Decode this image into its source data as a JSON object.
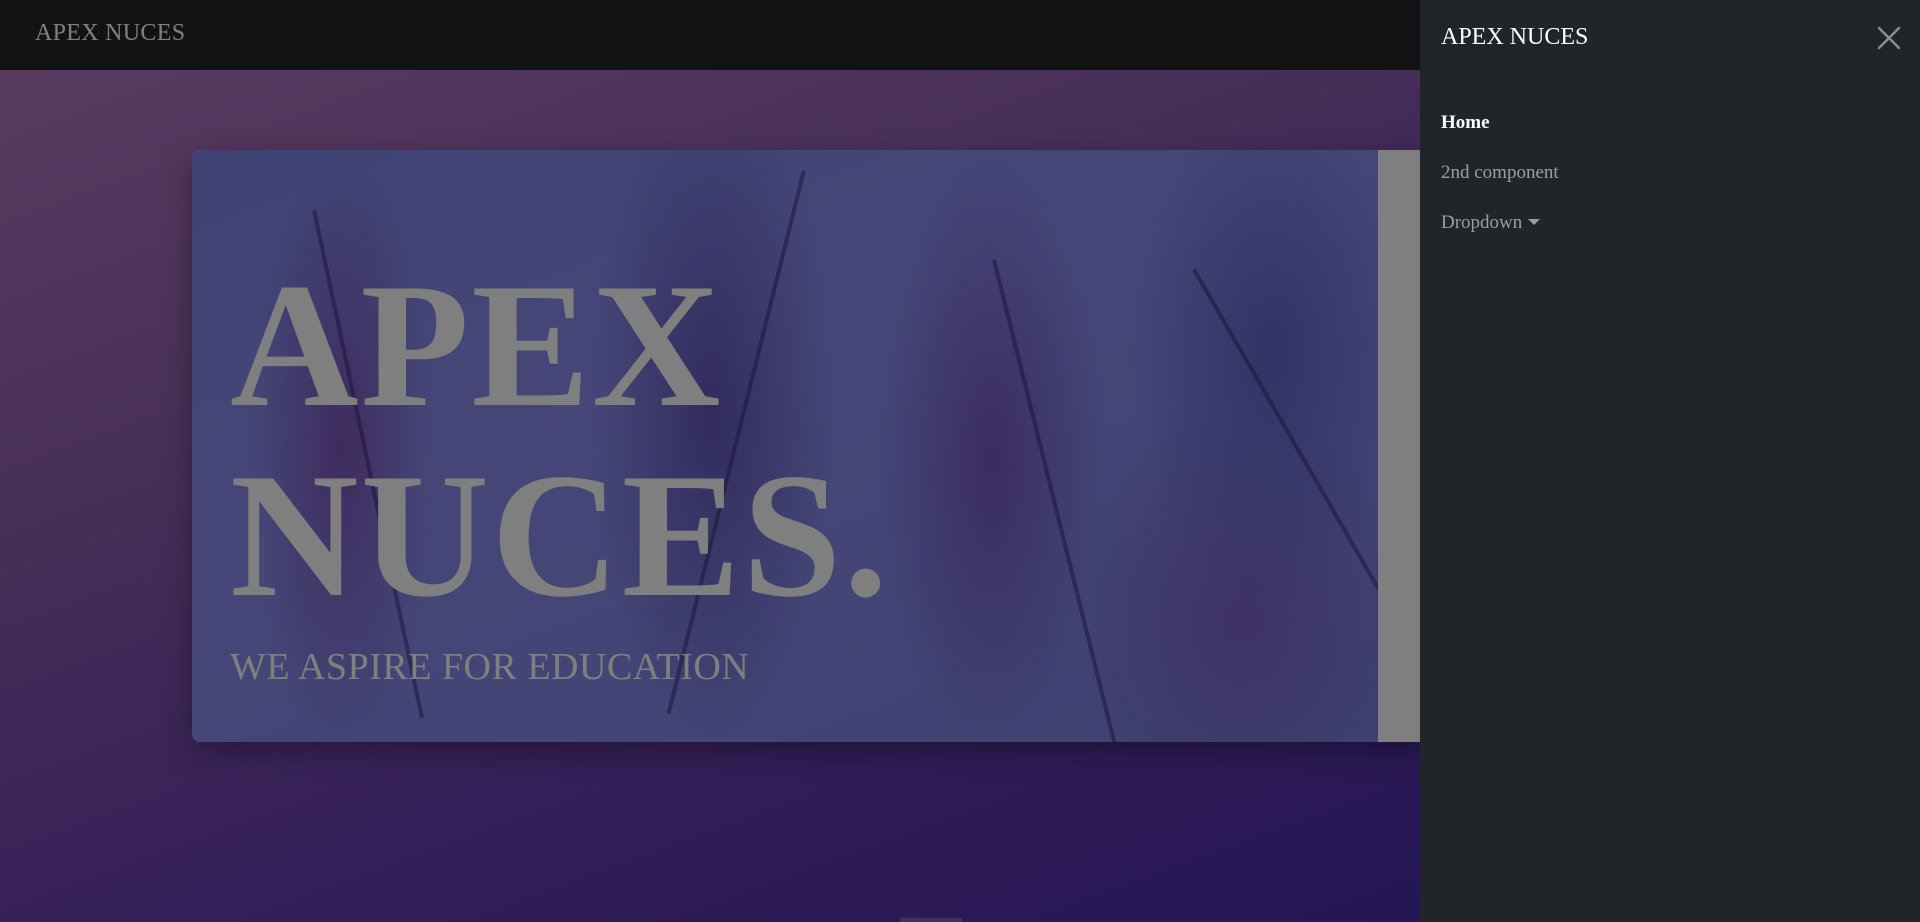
{
  "navbar": {
    "brand": "APEX NUCES"
  },
  "hero": {
    "title_line1": "APEX",
    "title_line2": "NUCES.",
    "tagline": "WE ASPIRE FOR EDUCATION"
  },
  "offcanvas": {
    "title": "APEX NUCES",
    "close_icon": "close-icon",
    "nav": {
      "home": "Home",
      "second": "2nd component",
      "dropdown": "Dropdown"
    }
  },
  "colors": {
    "navbar_bg": "#212529",
    "offcanvas_bg": "#212529",
    "backdrop_opacity": "0.5",
    "page_gradient_start": "#b679c1",
    "page_gradient_end": "#3b24a8"
  }
}
